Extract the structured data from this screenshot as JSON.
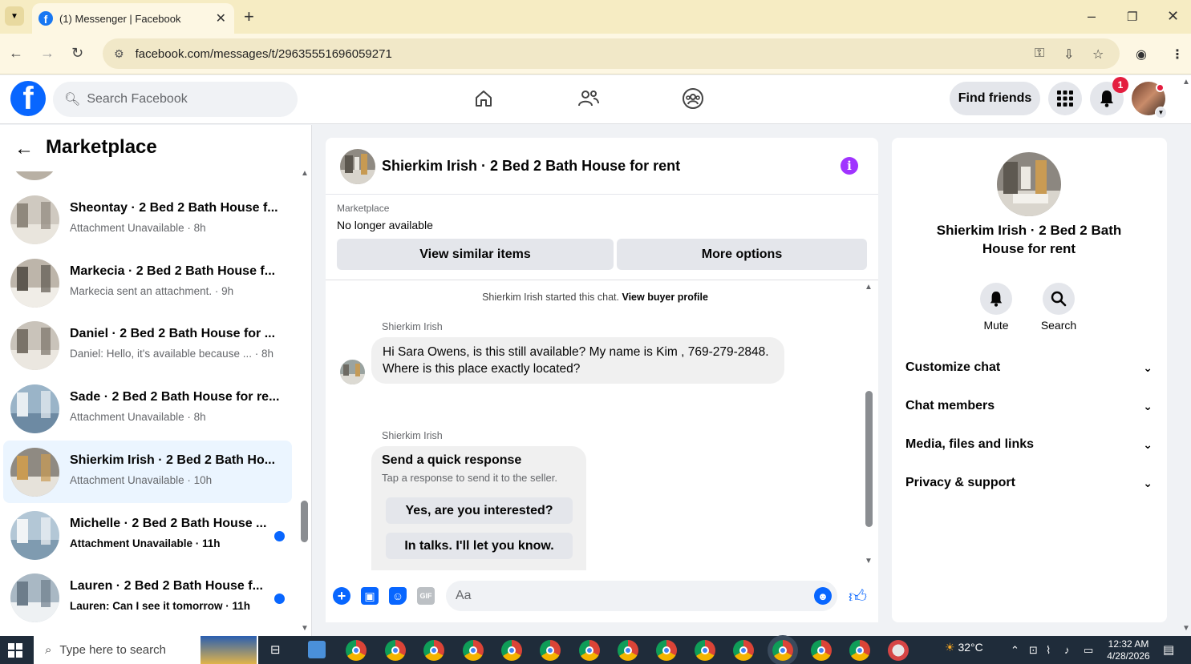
{
  "browser": {
    "tab_title": "(1) Messenger | Facebook",
    "url": "facebook.com/messages/t/29635551696059271",
    "new_tab": "+",
    "window": {
      "minimize": "–",
      "restore": "❐",
      "close": "✕"
    }
  },
  "fb_header": {
    "search_placeholder": "Search Facebook",
    "find_friends": "Find friends",
    "notification_count": "1"
  },
  "left_panel": {
    "title": "Marketplace",
    "conversations": [
      {
        "name": "Sheontay · 2 Bed 2 Bath House f...",
        "sub": "Attachment Unavailable · 8h",
        "unread": false,
        "active": false
      },
      {
        "name": "Markecia · 2 Bed 2 Bath House f...",
        "sub": "Markecia sent an attachment. · 9h",
        "unread": false,
        "active": false
      },
      {
        "name": "Daniel · 2 Bed 2 Bath House for ...",
        "sub": "Daniel: Hello, it's available because ... · 8h",
        "unread": false,
        "active": false
      },
      {
        "name": "Sade · 2 Bed 2 Bath House for re...",
        "sub": "Attachment Unavailable · 8h",
        "unread": false,
        "active": false
      },
      {
        "name": "Shierkim Irish · 2 Bed 2 Bath Ho...",
        "sub": "Attachment Unavailable · 10h",
        "unread": false,
        "active": true
      },
      {
        "name": "Michelle · 2 Bed 2 Bath House ...",
        "sub": "Attachment Unavailable · 11h",
        "unread": true,
        "active": false
      },
      {
        "name": "Lauren · 2 Bed 2 Bath House f...",
        "sub": "Lauren: Can I see it tomorrow · 11h",
        "unread": true,
        "active": false
      }
    ]
  },
  "chat": {
    "title": "Shierkim Irish · 2 Bed 2 Bath House for rent",
    "info_icon": "i",
    "marketplace_label": "Marketplace",
    "listing_status": "No longer available",
    "view_similar": "View similar items",
    "more_options": "More options",
    "started_text": "Shierkim Irish started this chat.",
    "buyer_profile_link": "View buyer profile",
    "messages": [
      {
        "sender": "Shierkim Irish",
        "text": "Hi Sara Owens, is this still available? My name is Kim , 769-279-2848. Where is this place exactly located?"
      }
    ],
    "quick_response": {
      "sender": "Shierkim Irish",
      "title": "Send a quick response",
      "subtitle": "Tap a response to send it to the seller.",
      "options": [
        "Yes, are you interested?",
        "In talks. I'll let you know."
      ]
    },
    "composer_placeholder": "Aa"
  },
  "right_panel": {
    "title": "Shierkim Irish · 2 Bed 2 Bath House for rent",
    "mute_label": "Mute",
    "search_label": "Search",
    "sections": [
      "Customize chat",
      "Chat members",
      "Media, files and links",
      "Privacy & support"
    ]
  },
  "taskbar": {
    "search_placeholder": "Type here to search",
    "weather": "32°C",
    "time": "12:32 AM",
    "date": "4/28/2026"
  },
  "colors": {
    "fb_blue": "#0866ff",
    "unread_dot": "#0866ff",
    "info_purple": "#a033ff",
    "active_row": "#ebf5ff",
    "browser_tab_bar": "#f6ecc3"
  },
  "icons": [
    "chevron-down-icon",
    "facebook-icon",
    "close-icon",
    "back-icon",
    "forward-icon",
    "reload-icon",
    "site-info-icon",
    "password-key-icon",
    "install-icon",
    "star-icon",
    "profile-icon",
    "kebab-menu-icon",
    "search-icon",
    "home-icon",
    "friends-icon",
    "groups-icon",
    "apps-grid-icon",
    "bell-icon",
    "info-icon",
    "plus-icon",
    "image-icon",
    "sticker-icon",
    "gif-icon",
    "emoji-icon",
    "thumbs-up-icon",
    "windows-start-icon"
  ]
}
